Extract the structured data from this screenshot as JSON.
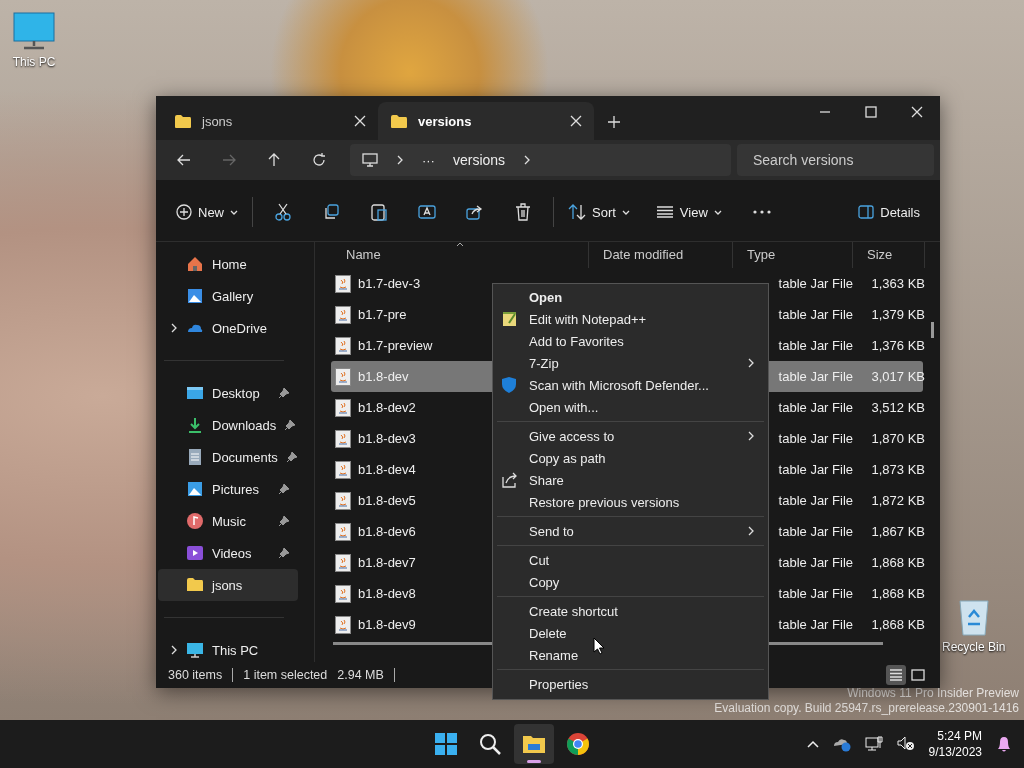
{
  "desktop_icons": [
    {
      "label": "This PC"
    },
    {
      "label": "Recycle Bin"
    }
  ],
  "window": {
    "tabs": [
      {
        "label": "jsons",
        "selected": false
      },
      {
        "label": "versions",
        "selected": true
      }
    ],
    "address": {
      "more": "···",
      "path": "versions"
    },
    "search": {
      "placeholder": "Search versions"
    },
    "toolbar": {
      "new": "New",
      "sort": "Sort",
      "view": "View",
      "details": "Details"
    },
    "sidebar": [
      [
        {
          "label": "Home",
          "expandable": false,
          "pinned": false,
          "selected": false
        },
        {
          "label": "Gallery",
          "expandable": false,
          "pinned": false,
          "selected": false
        },
        {
          "label": "OneDrive",
          "expandable": true,
          "pinned": false,
          "selected": false
        }
      ],
      [
        {
          "label": "Desktop",
          "expandable": false,
          "pinned": true,
          "selected": false
        },
        {
          "label": "Downloads",
          "expandable": false,
          "pinned": true,
          "selected": false
        },
        {
          "label": "Documents",
          "expandable": false,
          "pinned": true,
          "selected": false
        },
        {
          "label": "Pictures",
          "expandable": false,
          "pinned": true,
          "selected": false
        },
        {
          "label": "Music",
          "expandable": false,
          "pinned": true,
          "selected": false
        },
        {
          "label": "Videos",
          "expandable": false,
          "pinned": true,
          "selected": false
        },
        {
          "label": "jsons",
          "expandable": false,
          "pinned": false,
          "selected": true
        }
      ],
      [
        {
          "label": "This PC",
          "expandable": true,
          "pinned": false,
          "selected": false
        }
      ]
    ],
    "columns": [
      "Name",
      "Date modified",
      "Type",
      "Size"
    ],
    "rows": [
      {
        "name": "b1.7-dev-3",
        "type": "table Jar File",
        "size": "1,363 KB",
        "selected": false
      },
      {
        "name": "b1.7-pre",
        "type": "table Jar File",
        "size": "1,379 KB",
        "selected": false
      },
      {
        "name": "b1.7-preview",
        "type": "table Jar File",
        "size": "1,376 KB",
        "selected": false
      },
      {
        "name": "b1.8-dev",
        "type": "table Jar File",
        "size": "3,017 KB",
        "selected": true
      },
      {
        "name": "b1.8-dev2",
        "type": "table Jar File",
        "size": "3,512 KB",
        "selected": false
      },
      {
        "name": "b1.8-dev3",
        "type": "table Jar File",
        "size": "1,870 KB",
        "selected": false
      },
      {
        "name": "b1.8-dev4",
        "type": "table Jar File",
        "size": "1,873 KB",
        "selected": false
      },
      {
        "name": "b1.8-dev5",
        "type": "table Jar File",
        "size": "1,872 KB",
        "selected": false
      },
      {
        "name": "b1.8-dev6",
        "type": "table Jar File",
        "size": "1,867 KB",
        "selected": false
      },
      {
        "name": "b1.8-dev7",
        "type": "table Jar File",
        "size": "1,868 KB",
        "selected": false
      },
      {
        "name": "b1.8-dev8",
        "type": "table Jar File",
        "size": "1,868 KB",
        "selected": false
      },
      {
        "name": "b1.8-dev9",
        "type": "table Jar File",
        "size": "1,868 KB",
        "selected": false
      }
    ],
    "status_bar": {
      "items": "360 items",
      "selection": "1 item selected",
      "size": "2.94 MB"
    }
  },
  "context_menu": [
    [
      {
        "label": "Open",
        "default": true,
        "submenu": false
      },
      {
        "label": "Edit with Notepad++",
        "default": false,
        "submenu": false
      },
      {
        "label": "Add to Favorites",
        "default": false,
        "submenu": false
      },
      {
        "label": "7-Zip",
        "default": false,
        "submenu": true
      },
      {
        "label": "Scan with Microsoft Defender...",
        "default": false,
        "submenu": false
      },
      {
        "label": "Open with...",
        "default": false,
        "submenu": false
      }
    ],
    [
      {
        "label": "Give access to",
        "default": false,
        "submenu": true
      },
      {
        "label": "Copy as path",
        "default": false,
        "submenu": false
      },
      {
        "label": "Share",
        "default": false,
        "submenu": false
      },
      {
        "label": "Restore previous versions",
        "default": false,
        "submenu": false
      }
    ],
    [
      {
        "label": "Send to",
        "default": false,
        "submenu": true
      }
    ],
    [
      {
        "label": "Cut",
        "default": false,
        "submenu": false
      },
      {
        "label": "Copy",
        "default": false,
        "submenu": false
      }
    ],
    [
      {
        "label": "Create shortcut",
        "default": false,
        "submenu": false
      },
      {
        "label": "Delete",
        "default": false,
        "submenu": false
      },
      {
        "label": "Rename",
        "default": false,
        "submenu": false
      }
    ],
    [
      {
        "label": "Properties",
        "default": false,
        "submenu": false
      }
    ]
  ],
  "system_notice": [
    "Windows 11 Pro Insider Preview",
    "Evaluation copy. Build 25947.rs_prerelease.230901-1416"
  ],
  "taskbar": {
    "apps": [
      {
        "selected": false
      },
      {
        "selected": false
      },
      {
        "selected": true
      },
      {
        "selected": false
      }
    ],
    "time": "5:24 PM",
    "date": "9/13/2023"
  }
}
